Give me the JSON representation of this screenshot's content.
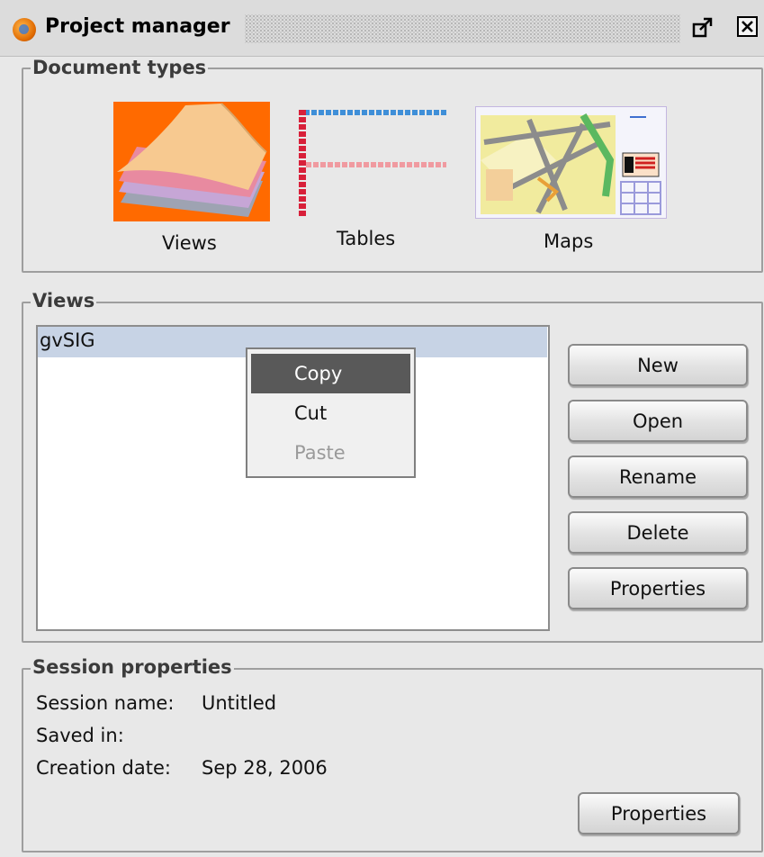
{
  "window": {
    "title": "Project manager",
    "icons": {
      "app": "gvsig-globe-icon",
      "maximize": "maximize-icon",
      "close": "close-icon"
    }
  },
  "document_types": {
    "group_title": "Document types",
    "items": [
      {
        "label": "Views",
        "icon": "views-layers-icon"
      },
      {
        "label": "Tables",
        "icon": "tables-icon"
      },
      {
        "label": "Maps",
        "icon": "maps-icon"
      }
    ]
  },
  "views": {
    "group_title": "Views",
    "list_items": [
      "gvSIG"
    ],
    "buttons": {
      "new": "New",
      "open": "Open",
      "rename": "Rename",
      "delete": "Delete",
      "properties": "Properties"
    }
  },
  "context_menu": {
    "items": [
      {
        "label": "Copy",
        "state": "highlighted"
      },
      {
        "label": "Cut",
        "state": "enabled"
      },
      {
        "label": "Paste",
        "state": "disabled"
      }
    ]
  },
  "session": {
    "group_title": "Session properties",
    "name_label": "Session name:",
    "name_value": "Untitled",
    "saved_label": "Saved in:",
    "saved_value": "",
    "date_label": "Creation date:",
    "date_value": "Sep 28, 2006",
    "properties_button": "Properties"
  },
  "colors": {
    "selection": "#c7d3e5",
    "menu_highlight": "#595959",
    "views_icon_bg": "#ff6a00"
  }
}
